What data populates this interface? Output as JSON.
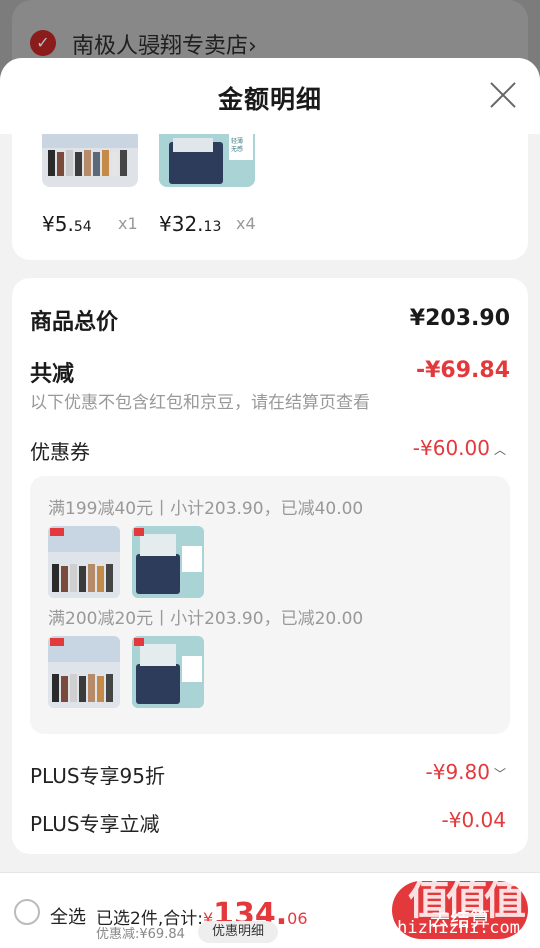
{
  "store": {
    "name": "南极人骎翔专卖店",
    "chevron": "›"
  },
  "sheet": {
    "title": "金额明细"
  },
  "products": [
    {
      "price_int": "¥5.",
      "price_dec": "54",
      "qty": "x1"
    },
    {
      "price_int": "¥32.",
      "price_dec": "13",
      "qty": "x4"
    }
  ],
  "product2_tag": {
    "line1": "轻薄",
    "line2": "无感",
    "small": "7A级 桑蚕丝 可能抑"
  },
  "summary": {
    "total_label": "商品总价",
    "total_value": "¥203.90",
    "discount_label": "共减",
    "discount_value": "-¥69.84",
    "note": "以下优惠不包含红包和京豆，请在结算页查看"
  },
  "coupon": {
    "label": "优惠券",
    "value": "-¥60.00",
    "items": [
      {
        "text": "满199减40元丨小计203.90，已减40.00"
      },
      {
        "text": "满200减20元丨小计203.90，已减20.00"
      }
    ]
  },
  "plus": [
    {
      "label": "PLUS专享95折",
      "value": "-¥9.80",
      "chevron": "﹀"
    },
    {
      "label": "PLUS专享立减",
      "value": "-¥0.04"
    }
  ],
  "bottom": {
    "select_all": "全选",
    "selected_text": "已选2件,合计:",
    "total_symbol": "¥",
    "total_int": "134.",
    "total_dec": "06",
    "saved_text": "优惠减:¥69.84",
    "detail_btn": "优惠明细",
    "checkout_btn": "去结算"
  },
  "watermark": {
    "logo": "值值值",
    "url": "zhizhizhi.com"
  },
  "colors": {
    "accent": "#e4393c",
    "sheet_bg": "#f2f2f2"
  }
}
